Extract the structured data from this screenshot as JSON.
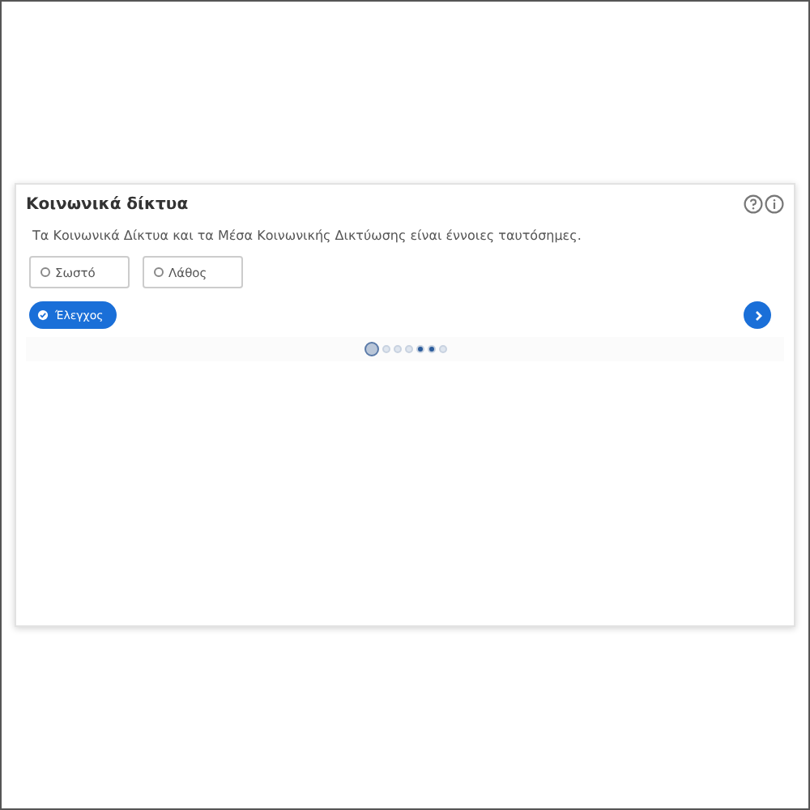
{
  "card": {
    "title": "Κοινωνικά δίκτυα",
    "question": "Τα Κοινωνικά Δίκτυα και τα Μέσα Κοινωνικής Δικτύωσης είναι έννοιες ταυτόσημες.",
    "options": [
      {
        "label": "Σωστό",
        "selected": false
      },
      {
        "label": "Λάθος",
        "selected": false
      }
    ],
    "check_button": "Έλεγχος",
    "pages": [
      {
        "selected": true,
        "answered": false
      },
      {
        "selected": false,
        "answered": false
      },
      {
        "selected": false,
        "answered": false
      },
      {
        "selected": false,
        "answered": false
      },
      {
        "selected": false,
        "answered": true
      },
      {
        "selected": false,
        "answered": true
      },
      {
        "selected": false,
        "answered": false
      }
    ]
  }
}
